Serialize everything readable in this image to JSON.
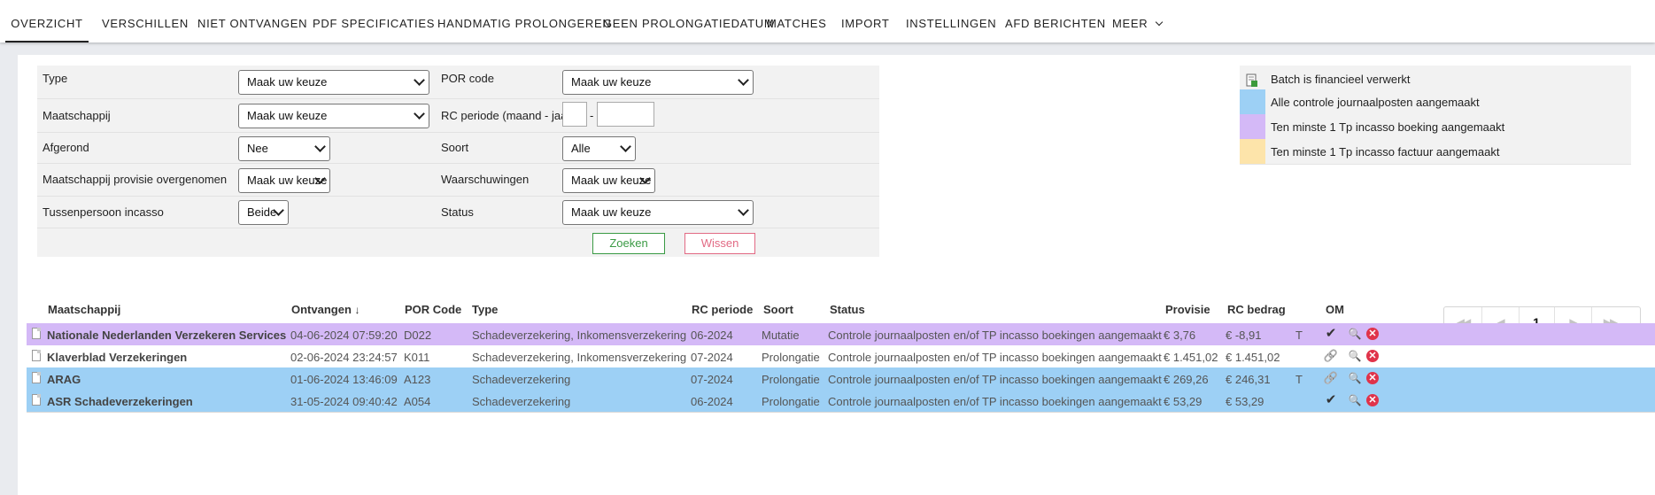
{
  "nav": {
    "tabs": [
      {
        "label": "OVERZICHT"
      },
      {
        "label": "VERSCHILLEN"
      },
      {
        "label": "NIET ONTVANGEN"
      },
      {
        "label": "PDF SPECIFICATIES"
      },
      {
        "label": "HANDMATIG PROLONGEREN"
      },
      {
        "label": "GEEN PROLONGATIEDATUM"
      },
      {
        "label": "MATCHES"
      },
      {
        "label": "IMPORT"
      },
      {
        "label": "INSTELLINGEN"
      },
      {
        "label": "AFD BERICHTEN"
      },
      {
        "label": "MEER"
      }
    ]
  },
  "filters": {
    "type_label": "Type",
    "type_value": "Maak uw keuze",
    "por_label": "POR code",
    "por_value": "Maak uw keuze",
    "maatschappij_label": "Maatschappij",
    "maatschappij_value": "Maak uw keuze",
    "rc_label": "RC periode (maand - jaar)",
    "rc_sep": "-",
    "afgerond_label": "Afgerond",
    "afgerond_value": "Nee",
    "soort_label": "Soort",
    "soort_value": "Alle",
    "provisie_label": "Maatschappij provisie overgenomen",
    "provisie_value": "Maak uw keuze",
    "waarschuwingen_label": "Waarschuwingen",
    "waarschuwingen_value": "Maak uw keuze",
    "tussenpersoon_label": "Tussenpersoon incasso",
    "tussenpersoon_value": "Beide",
    "status_label": "Status",
    "status_value": "Maak uw keuze",
    "search_label": "Zoeken",
    "clear_label": "Wissen"
  },
  "legend": [
    {
      "label": "Batch is financieel verwerkt",
      "color": "#f2f2f2"
    },
    {
      "label": "Alle controle journaalposten aangemaakt",
      "color": "#9dd0f5"
    },
    {
      "label": "Ten minste 1 Tp incasso boeking aangemaakt",
      "color": "#d4b9f7"
    },
    {
      "label": "Ten minste 1 Tp incasso factuur aangemaakt",
      "color": "#fde4aa"
    }
  ],
  "pager": {
    "current": "1"
  },
  "table": {
    "headers": {
      "maatschappij": "Maatschappij",
      "ontvangen": "Ontvangen",
      "por": "POR Code",
      "type": "Type",
      "rc": "RC periode",
      "soort": "Soort",
      "status": "Status",
      "provisie": "Provisie",
      "rcbedrag": "RC bedrag",
      "om": "OM"
    },
    "rows": [
      {
        "maatschappij": "Nationale Nederlanden Verzekeren Services",
        "ontvangen": "04-06-2024 07:59:20",
        "por": "D022",
        "type": "Schadeverzekering, Inkomensverzekering",
        "rc": "06-2024",
        "soort": "Mutatie",
        "status": "Controle journaalposten en/of TP incasso boekingen aangemaakt",
        "provisie": "€ 3,76",
        "rcbedrag": "€ -8,91",
        "t": "T",
        "bg": "#d4b9f7",
        "action": "check"
      },
      {
        "maatschappij": "Klaverblad Verzekeringen",
        "ontvangen": "02-06-2024 23:24:57",
        "por": "K011",
        "type": "Schadeverzekering, Inkomensverzekering",
        "rc": "07-2024",
        "soort": "Prolongatie",
        "status": "Controle journaalposten en/of TP incasso boekingen aangemaakt",
        "provisie": "€ 1.451,02",
        "rcbedrag": "€ 1.451,02",
        "t": "",
        "bg": "#ffffff",
        "action": "link"
      },
      {
        "maatschappij": "ARAG",
        "ontvangen": "01-06-2024 13:46:09",
        "por": "A123",
        "type": "Schadeverzekering",
        "rc": "07-2024",
        "soort": "Prolongatie",
        "status": "Controle journaalposten en/of TP incasso boekingen aangemaakt",
        "provisie": "€ 269,26",
        "rcbedrag": "€ 246,31",
        "t": "T",
        "bg": "#9dd0f5",
        "action": "link"
      },
      {
        "maatschappij": "ASR Schadeverzekeringen",
        "ontvangen": "31-05-2024 09:40:42",
        "por": "A054",
        "type": "Schadeverzekering",
        "rc": "06-2024",
        "soort": "Prolongatie",
        "status": "Controle journaalposten en/of TP incasso boekingen aangemaakt",
        "provisie": "€ 53,29",
        "rcbedrag": "€ 53,29",
        "t": "",
        "bg": "#9dd0f5",
        "action": "check"
      }
    ]
  },
  "icons": {
    "check": "✔",
    "link": "🔗",
    "search": "🔍",
    "remove": "✕",
    "sort_down": "🡓"
  }
}
